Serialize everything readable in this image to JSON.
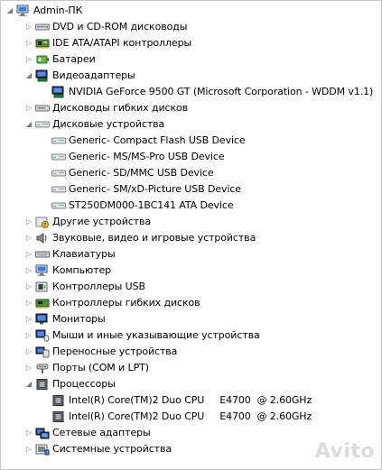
{
  "tree": [
    {
      "level": 0,
      "expanded": true,
      "icon": "computer-icon",
      "name": "node-admin-pc",
      "label": "Admin-ПК"
    },
    {
      "level": 1,
      "expanded": false,
      "icon": "dvd-drive-icon",
      "name": "category-dvd-cdrom",
      "label": "DVD и CD-ROM дисководы"
    },
    {
      "level": 1,
      "expanded": false,
      "icon": "ide-controller-icon",
      "name": "category-ide-ata",
      "label": "IDE ATA/ATAPI контроллеры"
    },
    {
      "level": 1,
      "expanded": false,
      "icon": "battery-icon",
      "name": "category-batteries",
      "label": "Батареи"
    },
    {
      "level": 1,
      "expanded": true,
      "icon": "display-adapter-icon",
      "name": "category-video-adapters",
      "label": "Видеоадаптеры"
    },
    {
      "level": 2,
      "expanded": null,
      "icon": "display-adapter-icon",
      "name": "device-nvidia-9500gt",
      "label": "NVIDIA GeForce 9500 GT (Microsoft Corporation - WDDM v1.1)"
    },
    {
      "level": 1,
      "expanded": false,
      "icon": "floppy-drive-icon",
      "name": "category-floppy-drives",
      "label": "Дисководы гибких дисков"
    },
    {
      "level": 1,
      "expanded": true,
      "icon": "disk-drive-icon",
      "name": "category-disk-drives",
      "label": "Дисковые устройства"
    },
    {
      "level": 2,
      "expanded": null,
      "icon": "disk-drive-icon",
      "name": "device-compact-flash",
      "label": "Generic- Compact Flash USB Device"
    },
    {
      "level": 2,
      "expanded": null,
      "icon": "disk-drive-icon",
      "name": "device-ms-pro",
      "label": "Generic- MS/MS-Pro USB Device"
    },
    {
      "level": 2,
      "expanded": null,
      "icon": "disk-drive-icon",
      "name": "device-sd-mmc",
      "label": "Generic- SD/MMC USB Device"
    },
    {
      "level": 2,
      "expanded": null,
      "icon": "disk-drive-icon",
      "name": "device-sm-xd",
      "label": "Generic- SM/xD-Picture USB Device"
    },
    {
      "level": 2,
      "expanded": null,
      "icon": "disk-drive-icon",
      "name": "device-st250dm000",
      "label": "ST250DM000-1BC141 ATA Device"
    },
    {
      "level": 1,
      "expanded": false,
      "icon": "unknown-device-icon",
      "name": "category-other-devices",
      "label": "Другие устройства"
    },
    {
      "level": 1,
      "expanded": false,
      "icon": "speaker-icon",
      "name": "category-sound-video-game",
      "label": "Звуковые, видео и игровые устройства"
    },
    {
      "level": 1,
      "expanded": false,
      "icon": "keyboard-icon",
      "name": "category-keyboards",
      "label": "Клавиатуры"
    },
    {
      "level": 1,
      "expanded": false,
      "icon": "computer-icon",
      "name": "category-computer",
      "label": "Компьютер"
    },
    {
      "level": 1,
      "expanded": false,
      "icon": "usb-icon",
      "name": "category-usb-controllers",
      "label": "Контроллеры USB"
    },
    {
      "level": 1,
      "expanded": false,
      "icon": "floppy-controller-icon",
      "name": "category-floppy-controllers",
      "label": "Контроллеры гибких дисков"
    },
    {
      "level": 1,
      "expanded": false,
      "icon": "monitor-icon",
      "name": "category-monitors",
      "label": "Мониторы"
    },
    {
      "level": 1,
      "expanded": false,
      "icon": "mouse-icon",
      "name": "category-mice",
      "label": "Мыши и иные указывающие устройства"
    },
    {
      "level": 1,
      "expanded": false,
      "icon": "portable-device-icon",
      "name": "category-portable-devices",
      "label": "Переносные устройства"
    },
    {
      "level": 1,
      "expanded": false,
      "icon": "port-icon",
      "name": "category-ports",
      "label": "Порты (COM и LPT)"
    },
    {
      "level": 1,
      "expanded": true,
      "icon": "processor-icon",
      "name": "category-processors",
      "label": "Процессоры"
    },
    {
      "level": 2,
      "expanded": null,
      "icon": "processor-icon",
      "name": "device-cpu-1",
      "label": "Intel(R) Core(TM)2 Duo CPU     E4700  @ 2.60GHz"
    },
    {
      "level": 2,
      "expanded": null,
      "icon": "processor-icon",
      "name": "device-cpu-2",
      "label": "Intel(R) Core(TM)2 Duo CPU     E4700  @ 2.60GHz"
    },
    {
      "level": 1,
      "expanded": false,
      "icon": "network-adapter-icon",
      "name": "category-network-adapters",
      "label": "Сетевые адаптеры"
    },
    {
      "level": 1,
      "expanded": false,
      "icon": "system-device-icon",
      "name": "category-system-devices",
      "label": "Системные устройства"
    }
  ],
  "watermark": "Avito"
}
